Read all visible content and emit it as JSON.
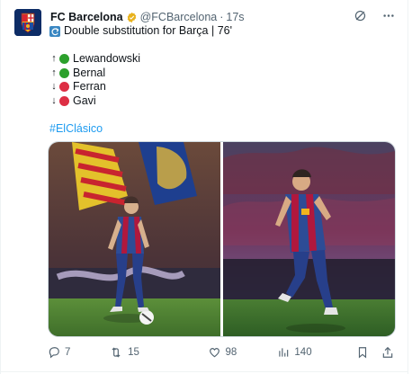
{
  "account": {
    "name": "FC Barcelona",
    "handle": "@FCBarcelona",
    "separator": "·",
    "time": "17s"
  },
  "tweet": {
    "headline": "Double substitution for Barça | 76'",
    "substitutions": [
      {
        "direction": "↑",
        "status": "green",
        "player": "Lewandowski"
      },
      {
        "direction": "↑",
        "status": "green",
        "player": "Bernal"
      },
      {
        "direction": "↓",
        "status": "red",
        "player": "Ferran"
      },
      {
        "direction": "↓",
        "status": "red",
        "player": "Gavi"
      }
    ],
    "hashtag": "#ElClásico"
  },
  "metrics": {
    "replies": "7",
    "retweets": "15",
    "likes": "98",
    "views": "140"
  },
  "colors": {
    "green": "#2ca02c",
    "red": "#dd2e44",
    "link": "#1d9bf0",
    "muted": "#536471",
    "verified": "#e8b21d"
  },
  "icons": [
    "grok-icon",
    "more-icon",
    "reply-icon",
    "retweet-icon",
    "like-icon",
    "views-icon",
    "bookmark-icon",
    "share-icon"
  ]
}
